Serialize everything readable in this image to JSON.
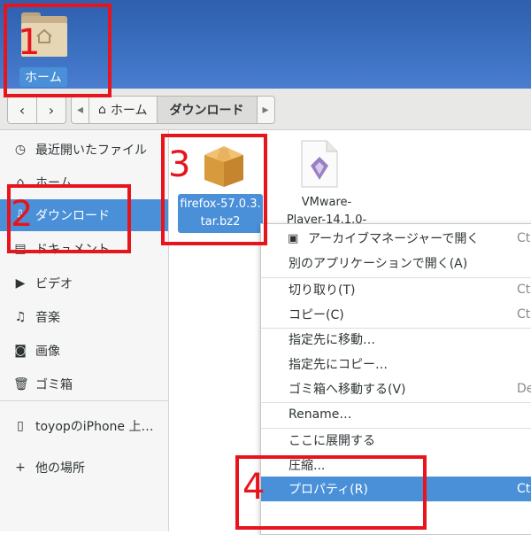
{
  "desktop": {
    "home_icon_label": "ホーム"
  },
  "toolbar": {
    "back_label": "‹",
    "forward_label": "›",
    "path_left_arrow": "◂",
    "path_home_label": "ホーム",
    "path_current_label": "ダウンロード",
    "path_right_arrow": "▸"
  },
  "sidebar": {
    "items": [
      {
        "label": "最近開いたファイル",
        "icon": "clock-icon"
      },
      {
        "label": "ホーム",
        "icon": "home-icon"
      },
      {
        "label": "ダウンロード",
        "icon": "download-icon"
      },
      {
        "label": "ドキュメント",
        "icon": "document-icon"
      },
      {
        "label": "ビデオ",
        "icon": "video-icon"
      },
      {
        "label": "音楽",
        "icon": "music-icon"
      },
      {
        "label": "画像",
        "icon": "camera-icon"
      },
      {
        "label": "ゴミ箱",
        "icon": "trash-icon"
      },
      {
        "label": "toyopのiPhone 上…",
        "icon": "phone-icon"
      },
      {
        "label": "他の場所",
        "icon": "plus-icon"
      }
    ],
    "selected": "ダウンロード"
  },
  "files": [
    {
      "name_line1": "firefox-57.0.3.",
      "name_line2": "tar.bz2",
      "icon": "package-icon"
    },
    {
      "name_line1": "VMware-",
      "name_line2": "Player-14.1.0-",
      "icon": "vmware-file-icon"
    }
  ],
  "context_menu": {
    "items": [
      {
        "label": "アーカイブマネージャーで開く",
        "shortcut": "Ctr"
      },
      {
        "label": "別のアプリケーションで開く(A)",
        "shortcut": ""
      },
      {
        "label": "切り取り(T)",
        "shortcut": "Ct"
      },
      {
        "label": "コピー(C)",
        "shortcut": "Ct"
      },
      {
        "label": "指定先に移動…",
        "shortcut": ""
      },
      {
        "label": "指定先にコピー…",
        "shortcut": ""
      },
      {
        "label": "ゴミ箱へ移動する(V)",
        "shortcut": "De"
      },
      {
        "label": "Rename…",
        "shortcut": ""
      },
      {
        "label": "ここに展開する",
        "shortcut": ""
      },
      {
        "label": "圧縮...",
        "shortcut": ""
      },
      {
        "label": "プロパティ(R)",
        "shortcut": "Ct"
      }
    ],
    "highlighted": "プロパティ(R)"
  },
  "annotations": [
    "1",
    "2",
    "3",
    "4"
  ],
  "colors": {
    "selection": "#4a90d9",
    "annotation": "#e8141c",
    "desktop": "#3b6fc0"
  }
}
